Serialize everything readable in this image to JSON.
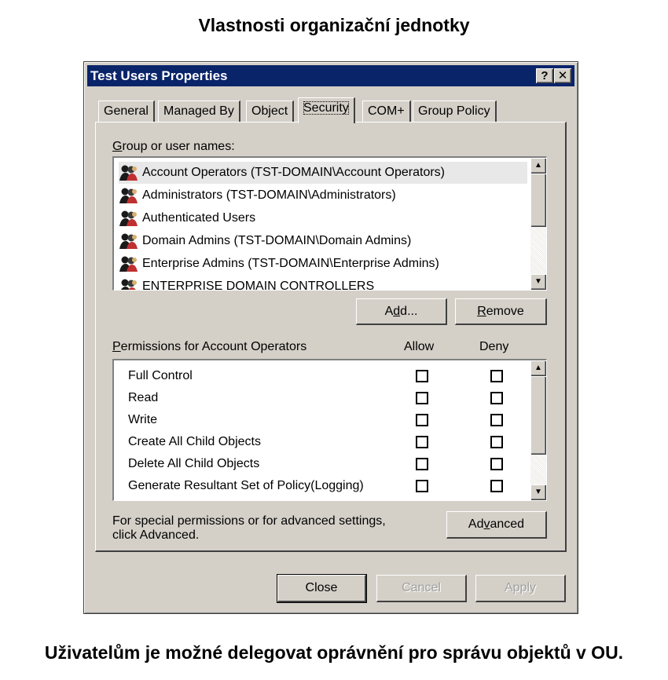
{
  "slide_title": "Vlastnosti organizační jednotky",
  "caption": "Uživatelům je možné delegovat oprávnění pro správu objektů v OU.",
  "dialog": {
    "title": "Test Users Properties",
    "help_glyph": "?",
    "close_glyph": "✕",
    "tabs": [
      "General",
      "Managed By",
      "Object",
      "Security",
      "COM+",
      "Group Policy"
    ],
    "active_tab": "Security",
    "group_label_prefix": "G",
    "group_label_rest": "roup or user names:",
    "users": [
      "Account Operators (TST-DOMAIN\\Account Operators)",
      "Administrators (TST-DOMAIN\\Administrators)",
      "Authenticated Users",
      "Domain Admins (TST-DOMAIN\\Domain Admins)",
      "Enterprise Admins (TST-DOMAIN\\Enterprise Admins)",
      "ENTERPRISE DOMAIN CONTROLLERS"
    ],
    "selected_user": "Account Operators (TST-DOMAIN\\Account Operators)",
    "add_pre": "A",
    "add_mnemonic": "d",
    "add_post": "d...",
    "remove_mnemonic": "R",
    "remove_post": "emove",
    "permissions_mnemonic": "P",
    "permissions_rest": "ermissions for Account Operators",
    "allow_header": "Allow",
    "deny_header": "Deny",
    "permissions": [
      {
        "name": "Full Control",
        "allow": false,
        "deny": false
      },
      {
        "name": "Read",
        "allow": false,
        "deny": false
      },
      {
        "name": "Write",
        "allow": false,
        "deny": false
      },
      {
        "name": "Create All Child Objects",
        "allow": false,
        "deny": false
      },
      {
        "name": "Delete All Child Objects",
        "allow": false,
        "deny": false
      },
      {
        "name": "Generate Resultant Set of Policy(Logging)",
        "allow": false,
        "deny": false
      }
    ],
    "advanced_hint_line1": "For special permissions or for advanced settings,",
    "advanced_hint_line2": "click Advanced.",
    "advanced_pre": "Ad",
    "advanced_mnemonic": "v",
    "advanced_post": "anced",
    "close_label": "Close",
    "cancel_label": "Cancel",
    "apply_label": "Apply",
    "colors": {
      "titlebar": "#0a246a",
      "face": "#d4d0c8"
    }
  }
}
